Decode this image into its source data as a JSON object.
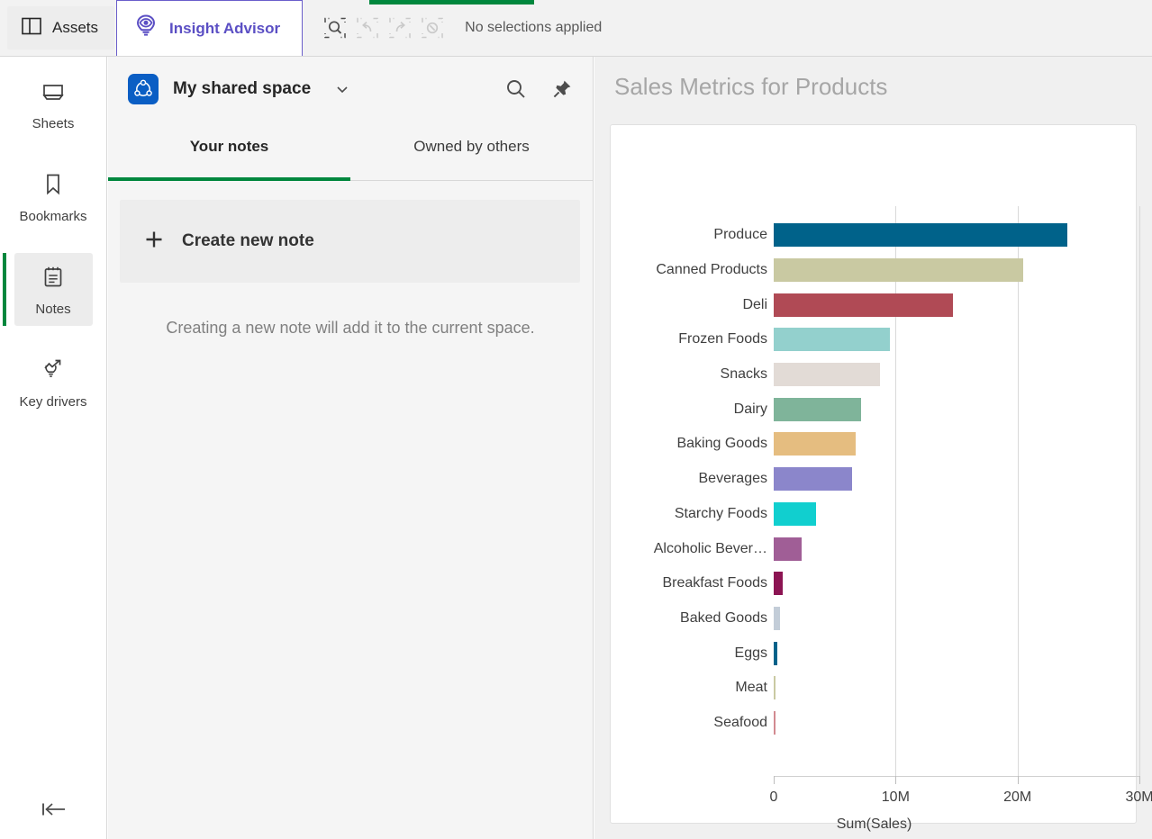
{
  "topbar": {
    "assets_label": "Assets",
    "insight_advisor_label": "Insight Advisor",
    "selections_text": "No selections applied",
    "tools": [
      {
        "name": "selection-search",
        "disabled": false
      },
      {
        "name": "selection-undo",
        "disabled": true
      },
      {
        "name": "selection-redo",
        "disabled": true
      },
      {
        "name": "clear-selections",
        "disabled": true
      }
    ],
    "accent_purple": "#5b4fc4",
    "accent_green": "#00873d"
  },
  "rail": {
    "items": [
      {
        "label": "Sheets",
        "icon": "sheets-icon",
        "active": false
      },
      {
        "label": "Bookmarks",
        "icon": "bookmark-icon",
        "active": false
      },
      {
        "label": "Notes",
        "icon": "notes-icon",
        "active": true
      },
      {
        "label": "Key drivers",
        "icon": "key-drivers-icon",
        "active": false
      }
    ],
    "collapse_icon": "collapse-left-icon"
  },
  "notes": {
    "space_name": "My shared space",
    "space_icon": "shared-space-icon",
    "caret_icon": "chevron-down-icon",
    "search_icon": "search-icon",
    "pin_icon": "pin-icon",
    "tabs": [
      {
        "label": "Your notes",
        "active": true
      },
      {
        "label": "Owned by others",
        "active": false
      }
    ],
    "create_note_label": "Create new note",
    "create_note_icon": "plus-icon",
    "hint": "Creating a new note will add it to the current space."
  },
  "chart_panel": {
    "title": "Sales Metrics for Products"
  },
  "chart_data": {
    "type": "bar",
    "orientation": "horizontal",
    "title": "Sales Metrics for Products",
    "xlabel": "Sum(Sales)",
    "ylabel": "",
    "xlim": [
      0,
      30000000
    ],
    "xticks": [
      0,
      10000000,
      20000000,
      30000000
    ],
    "xtick_labels": [
      "0",
      "10M",
      "20M",
      "30M"
    ],
    "grid": true,
    "legend": "none",
    "categories": [
      "Produce",
      "Canned Products",
      "Deli",
      "Frozen Foods",
      "Snacks",
      "Dairy",
      "Baking Goods",
      "Beverages",
      "Starchy Foods",
      "Alcoholic Bever…",
      "Breakfast Foods",
      "Baked Goods",
      "Eggs",
      "Meat",
      "Seafood"
    ],
    "values": [
      24100000,
      20500000,
      14700000,
      9550000,
      8700000,
      7200000,
      6750000,
      6400000,
      3500000,
      2300000,
      760000,
      520000,
      300000,
      40000,
      30000
    ],
    "colors": [
      "#00628a",
      "#c9c9a2",
      "#b04a55",
      "#93d0cd",
      "#e2dbd6",
      "#7fb49a",
      "#e5bd80",
      "#8b86cb",
      "#11cfcf",
      "#a05e96",
      "#8c1453",
      "#c3cdd8",
      "#00628a",
      "#c9c9a2",
      "#d28a90"
    ]
  }
}
